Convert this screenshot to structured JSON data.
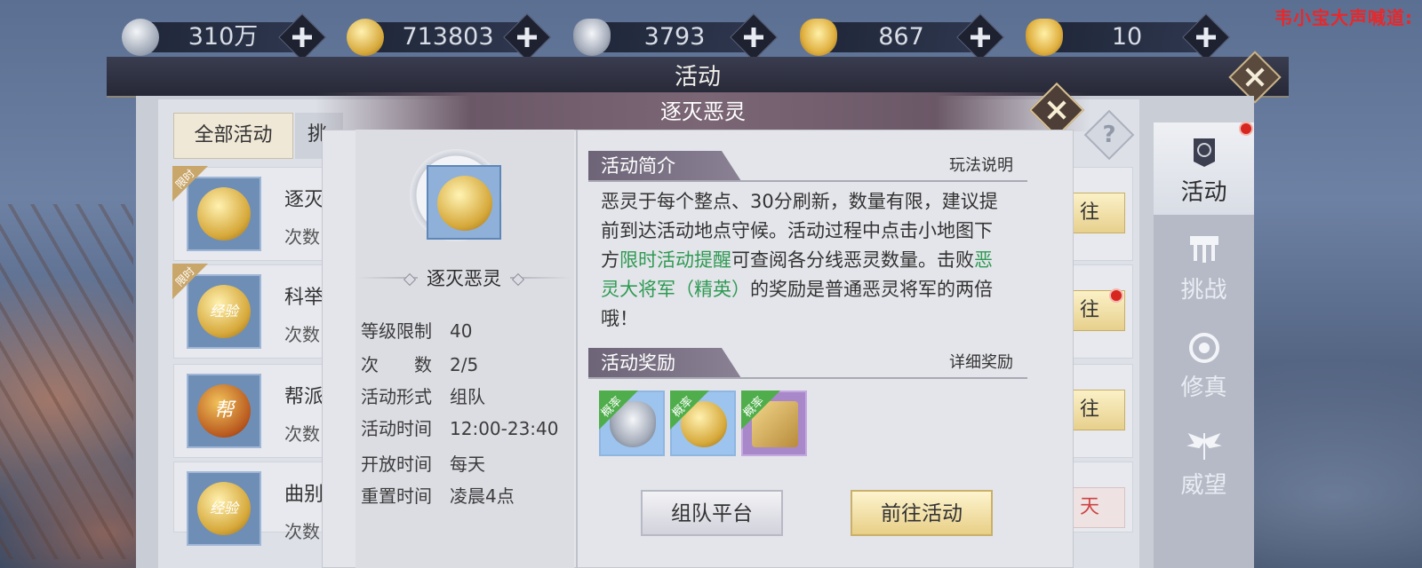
{
  "currencies": [
    {
      "icon": "silver-coin-icon",
      "value": "310万"
    },
    {
      "icon": "gold-coin-icon",
      "value": "713803"
    },
    {
      "icon": "silver-ingot-icon",
      "value": "3793"
    },
    {
      "icon": "bound-gold-ingot-icon",
      "value": "867"
    },
    {
      "icon": "gold-ingot-icon",
      "value": "10"
    }
  ],
  "chat_shout": "韦小宝大声喊道:",
  "window": {
    "title": "活动"
  },
  "tabs": {
    "all": "全部活动",
    "second": "挑"
  },
  "list": [
    {
      "name": "逐灭",
      "sub": "次数",
      "badge": "限时",
      "go": "往"
    },
    {
      "name": "科举",
      "sub": "次数",
      "badge": "限时",
      "go": "往",
      "icon_text": "经验"
    },
    {
      "name": "帮派",
      "sub": "次数",
      "go": "往",
      "icon_text": "帮"
    },
    {
      "name": "曲别",
      "sub": "次数",
      "go": "天",
      "icon_text": "经验"
    }
  ],
  "side_nav": [
    {
      "label": "活动",
      "icon": "activity-banner-icon"
    },
    {
      "label": "挑战",
      "icon": "challenge-icon"
    },
    {
      "label": "修真",
      "icon": "cultivation-icon"
    },
    {
      "label": "威望",
      "icon": "prestige-wings-icon"
    }
  ],
  "popup": {
    "title": "逐灭恶灵",
    "activity_name": "逐灭恶灵",
    "info": [
      {
        "label": "等级限制",
        "value": "40"
      },
      {
        "label": "次　　数",
        "value": "2/5"
      },
      {
        "label": "活动形式",
        "value": "组队"
      },
      {
        "label": "活动时间",
        "value": "12:00-23:40"
      },
      {
        "label": "开放时间",
        "value": "每天"
      },
      {
        "label": "重置时间",
        "value": "凌晨4点"
      }
    ],
    "intro_title": "活动简介",
    "intro_link": "玩法说明",
    "desc_1": "恶灵于每个整点、30分刷新，数量有限，建议提前到达活动地点守候。活动过程中点击小地图下方",
    "desc_hl_1": "限时活动提醒",
    "desc_2": "可查阅各分线恶灵数量。击败",
    "desc_hl_2": "恶灵大将军（精英）",
    "desc_3": "的奖励是普通恶灵将军的两倍哦！",
    "reward_title": "活动奖励",
    "reward_link": "详细奖励",
    "rewards": [
      {
        "icon": "silver-ingot-icon",
        "tag": "概率"
      },
      {
        "icon": "gold-coin-icon",
        "tag": "概率"
      },
      {
        "icon": "treasure-map-icon",
        "tag": "概率"
      }
    ],
    "btn_team": "组队平台",
    "btn_go": "前往活动"
  }
}
